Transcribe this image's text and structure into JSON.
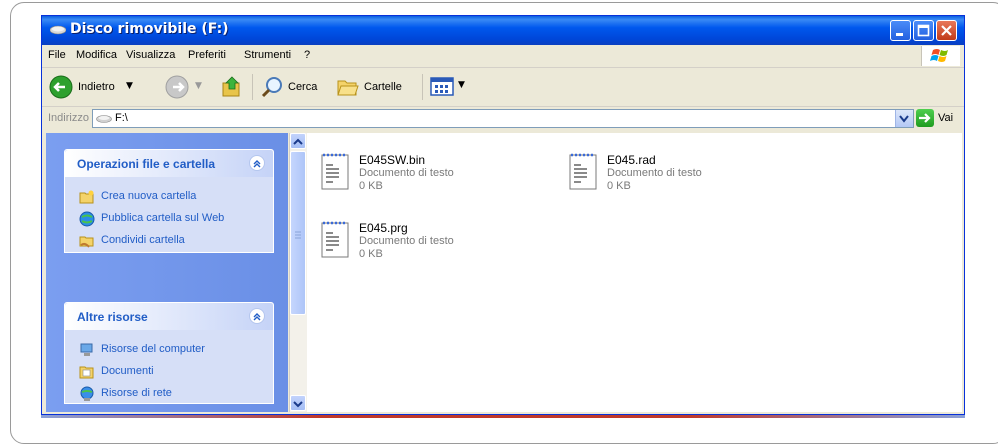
{
  "window": {
    "title": "Disco rimovibile (F:)"
  },
  "menu": [
    "File",
    "Modifica",
    "Visualizza",
    "Preferiti",
    "Strumenti",
    "?"
  ],
  "toolbar": {
    "back_label": "Indietro",
    "search_label": "Cerca",
    "folders_label": "Cartelle"
  },
  "address": {
    "label": "Indirizzo",
    "value": "F:\\",
    "go_label": "Vai"
  },
  "panels": {
    "file_ops": {
      "title": "Operazioni file e cartella",
      "items": [
        {
          "label": "Crea nuova cartella",
          "icon": "new-folder-icon"
        },
        {
          "label": "Pubblica cartella sul Web",
          "icon": "publish-web-icon"
        },
        {
          "label": "Condividi cartella",
          "icon": "share-folder-icon"
        }
      ]
    },
    "other": {
      "title": "Altre risorse",
      "items": [
        {
          "label": "Risorse del computer",
          "icon": "computer-icon"
        },
        {
          "label": "Documenti",
          "icon": "documents-icon"
        },
        {
          "label": "Risorse di rete",
          "icon": "network-icon"
        }
      ]
    }
  },
  "files": [
    {
      "name": "E045SW.bin",
      "type": "Documento di testo",
      "size": "0 KB"
    },
    {
      "name": "E045.rad",
      "type": "Documento di testo",
      "size": "0 KB"
    },
    {
      "name": "E045.prg",
      "type": "Documento di testo",
      "size": "0 KB"
    }
  ],
  "colors": {
    "titlebar": "#0058ee",
    "task_link": "#215dc6",
    "taskpane_bg": "#6a8fe6"
  }
}
